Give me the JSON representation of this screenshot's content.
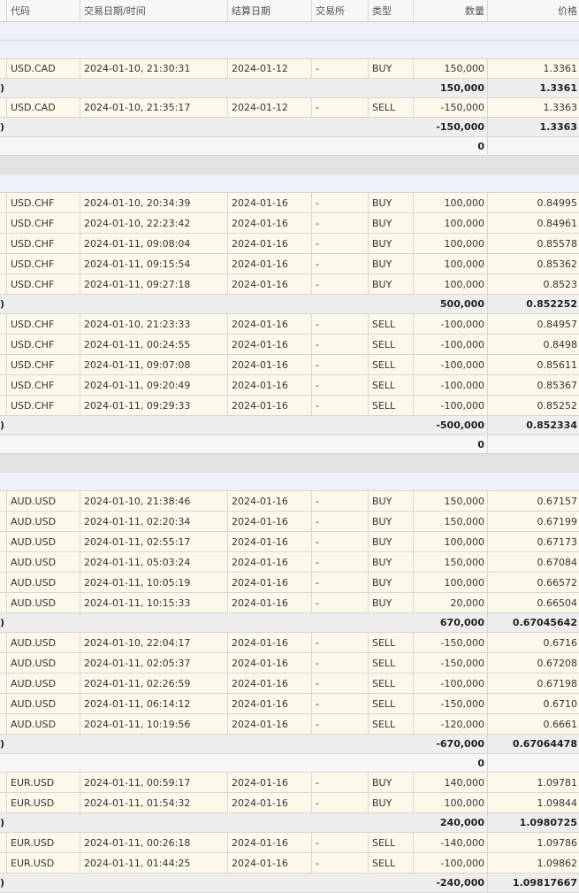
{
  "header": {
    "col_code": "代码",
    "col_datetime": "交易日期/时间",
    "col_settle": "结算日期",
    "col_exchange": "交易所",
    "col_type": "类型",
    "col_qty": "数量",
    "col_price": "价格"
  },
  "rows": [
    {
      "kind": "blank",
      "style": "blue",
      "h": 21
    },
    {
      "kind": "blank",
      "style": "blue",
      "h": 21
    },
    {
      "kind": "trade",
      "h": 22,
      "code": "USD.CAD",
      "dt": "2024-01-10, 21:30:31",
      "settle": "2024-01-12",
      "exch": "-",
      "type": "BUY",
      "qty": "150,000",
      "price": "1.3361"
    },
    {
      "kind": "sub",
      "h": 22,
      "edge": ")",
      "qty": "150,000",
      "price": "1.3361"
    },
    {
      "kind": "trade",
      "h": 22,
      "code": "USD.CAD",
      "dt": "2024-01-10, 21:35:17",
      "settle": "2024-01-12",
      "exch": "-",
      "type": "SELL",
      "qty": "-150,000",
      "price": "1.3363"
    },
    {
      "kind": "sub",
      "h": 22,
      "edge": ")",
      "qty": "-150,000",
      "price": "1.3363"
    },
    {
      "kind": "zero",
      "h": 21,
      "qty": "0"
    },
    {
      "kind": "blank",
      "style": "gray",
      "h": 21
    },
    {
      "kind": "blank",
      "style": "blue",
      "h": 21
    },
    {
      "kind": "trade",
      "h": 23,
      "code": "USD.CHF",
      "dt": "2024-01-10, 20:34:39",
      "settle": "2024-01-16",
      "exch": "-",
      "type": "BUY",
      "qty": "100,000",
      "price": "0.84995"
    },
    {
      "kind": "trade",
      "h": 23,
      "code": "USD.CHF",
      "dt": "2024-01-10, 22:23:42",
      "settle": "2024-01-16",
      "exch": "-",
      "type": "BUY",
      "qty": "100,000",
      "price": "0.84961"
    },
    {
      "kind": "trade",
      "h": 23,
      "code": "USD.CHF",
      "dt": "2024-01-11, 09:08:04",
      "settle": "2024-01-16",
      "exch": "-",
      "type": "BUY",
      "qty": "100,000",
      "price": "0.85578"
    },
    {
      "kind": "trade",
      "h": 23,
      "code": "USD.CHF",
      "dt": "2024-01-11, 09:15:54",
      "settle": "2024-01-16",
      "exch": "-",
      "type": "BUY",
      "qty": "100,000",
      "price": "0.85362"
    },
    {
      "kind": "trade",
      "h": 23,
      "code": "USD.CHF",
      "dt": "2024-01-11, 09:27:18",
      "settle": "2024-01-16",
      "exch": "-",
      "type": "BUY",
      "qty": "100,000",
      "price": "0.8523"
    },
    {
      "kind": "sub",
      "h": 22,
      "edge": ")",
      "qty": "500,000",
      "price": "0.852252"
    },
    {
      "kind": "trade",
      "h": 23,
      "code": "USD.CHF",
      "dt": "2024-01-10, 21:23:33",
      "settle": "2024-01-16",
      "exch": "-",
      "type": "SELL",
      "qty": "-100,000",
      "price": "0.84957"
    },
    {
      "kind": "trade",
      "h": 23,
      "code": "USD.CHF",
      "dt": "2024-01-11, 00:24:55",
      "settle": "2024-01-16",
      "exch": "-",
      "type": "SELL",
      "qty": "-100,000",
      "price": "0.8498"
    },
    {
      "kind": "trade",
      "h": 23,
      "code": "USD.CHF",
      "dt": "2024-01-11, 09:07:08",
      "settle": "2024-01-16",
      "exch": "-",
      "type": "SELL",
      "qty": "-100,000",
      "price": "0.85611"
    },
    {
      "kind": "trade",
      "h": 23,
      "code": "USD.CHF",
      "dt": "2024-01-11, 09:20:49",
      "settle": "2024-01-16",
      "exch": "-",
      "type": "SELL",
      "qty": "-100,000",
      "price": "0.85367"
    },
    {
      "kind": "trade",
      "h": 23,
      "code": "USD.CHF",
      "dt": "2024-01-11, 09:29:33",
      "settle": "2024-01-16",
      "exch": "-",
      "type": "SELL",
      "qty": "-100,000",
      "price": "0.85252"
    },
    {
      "kind": "sub",
      "h": 22,
      "edge": ")",
      "qty": "-500,000",
      "price": "0.852334"
    },
    {
      "kind": "zero",
      "h": 21,
      "qty": "0"
    },
    {
      "kind": "blank",
      "style": "gray",
      "h": 21
    },
    {
      "kind": "blank",
      "style": "blue",
      "h": 21
    },
    {
      "kind": "trade",
      "h": 23,
      "code": "AUD.USD",
      "dt": "2024-01-10, 21:38:46",
      "settle": "2024-01-16",
      "exch": "-",
      "type": "BUY",
      "qty": "150,000",
      "price": "0.67157"
    },
    {
      "kind": "trade",
      "h": 23,
      "code": "AUD.USD",
      "dt": "2024-01-11, 02:20:34",
      "settle": "2024-01-16",
      "exch": "-",
      "type": "BUY",
      "qty": "150,000",
      "price": "0.67199"
    },
    {
      "kind": "trade",
      "h": 23,
      "code": "AUD.USD",
      "dt": "2024-01-11, 02:55:17",
      "settle": "2024-01-16",
      "exch": "-",
      "type": "BUY",
      "qty": "100,000",
      "price": "0.67173"
    },
    {
      "kind": "trade",
      "h": 23,
      "code": "AUD.USD",
      "dt": "2024-01-11, 05:03:24",
      "settle": "2024-01-16",
      "exch": "-",
      "type": "BUY",
      "qty": "150,000",
      "price": "0.67084"
    },
    {
      "kind": "trade",
      "h": 23,
      "code": "AUD.USD",
      "dt": "2024-01-11, 10:05:19",
      "settle": "2024-01-16",
      "exch": "-",
      "type": "BUY",
      "qty": "100,000",
      "price": "0.66572"
    },
    {
      "kind": "trade",
      "h": 23,
      "code": "AUD.USD",
      "dt": "2024-01-11, 10:15:33",
      "settle": "2024-01-16",
      "exch": "-",
      "type": "BUY",
      "qty": "20,000",
      "price": "0.66504"
    },
    {
      "kind": "sub",
      "h": 22,
      "edge": ")",
      "qty": "670,000",
      "price": "0.67045642"
    },
    {
      "kind": "trade",
      "h": 23,
      "code": "AUD.USD",
      "dt": "2024-01-10, 22:04:17",
      "settle": "2024-01-16",
      "exch": "-",
      "type": "SELL",
      "qty": "-150,000",
      "price": "0.6716"
    },
    {
      "kind": "trade",
      "h": 23,
      "code": "AUD.USD",
      "dt": "2024-01-11, 02:05:37",
      "settle": "2024-01-16",
      "exch": "-",
      "type": "SELL",
      "qty": "-150,000",
      "price": "0.67208"
    },
    {
      "kind": "trade",
      "h": 23,
      "code": "AUD.USD",
      "dt": "2024-01-11, 02:26:59",
      "settle": "2024-01-16",
      "exch": "-",
      "type": "SELL",
      "qty": "-100,000",
      "price": "0.67198"
    },
    {
      "kind": "trade",
      "h": 23,
      "code": "AUD.USD",
      "dt": "2024-01-11, 06:14:12",
      "settle": "2024-01-16",
      "exch": "-",
      "type": "SELL",
      "qty": "-150,000",
      "price": "0.6710"
    },
    {
      "kind": "trade",
      "h": 23,
      "code": "AUD.USD",
      "dt": "2024-01-11, 10:19:56",
      "settle": "2024-01-16",
      "exch": "-",
      "type": "SELL",
      "qty": "-120,000",
      "price": "0.6661"
    },
    {
      "kind": "sub",
      "h": 22,
      "edge": ")",
      "qty": "-670,000",
      "price": "0.67064478"
    },
    {
      "kind": "zero",
      "h": 21,
      "qty": "0"
    },
    {
      "kind": "trade",
      "h": 23,
      "code": "EUR.USD",
      "dt": "2024-01-11, 00:59:17",
      "settle": "2024-01-16",
      "exch": "-",
      "type": "BUY",
      "qty": "140,000",
      "price": "1.09781"
    },
    {
      "kind": "trade",
      "h": 23,
      "code": "EUR.USD",
      "dt": "2024-01-11, 01:54:32",
      "settle": "2024-01-16",
      "exch": "-",
      "type": "BUY",
      "qty": "100,000",
      "price": "1.09844"
    },
    {
      "kind": "sub",
      "h": 22,
      "edge": ")",
      "qty": "240,000",
      "price": "1.0980725"
    },
    {
      "kind": "trade",
      "h": 23,
      "code": "EUR.USD",
      "dt": "2024-01-11, 00:26:18",
      "settle": "2024-01-16",
      "exch": "-",
      "type": "SELL",
      "qty": "-140,000",
      "price": "1.09786"
    },
    {
      "kind": "trade",
      "h": 23,
      "code": "EUR.USD",
      "dt": "2024-01-11, 01:44:25",
      "settle": "2024-01-16",
      "exch": "-",
      "type": "SELL",
      "qty": "-100,000",
      "price": "1.09862"
    },
    {
      "kind": "sub",
      "h": 22,
      "edge": ")",
      "qty": "-240,000",
      "price": "1.09817667"
    }
  ]
}
